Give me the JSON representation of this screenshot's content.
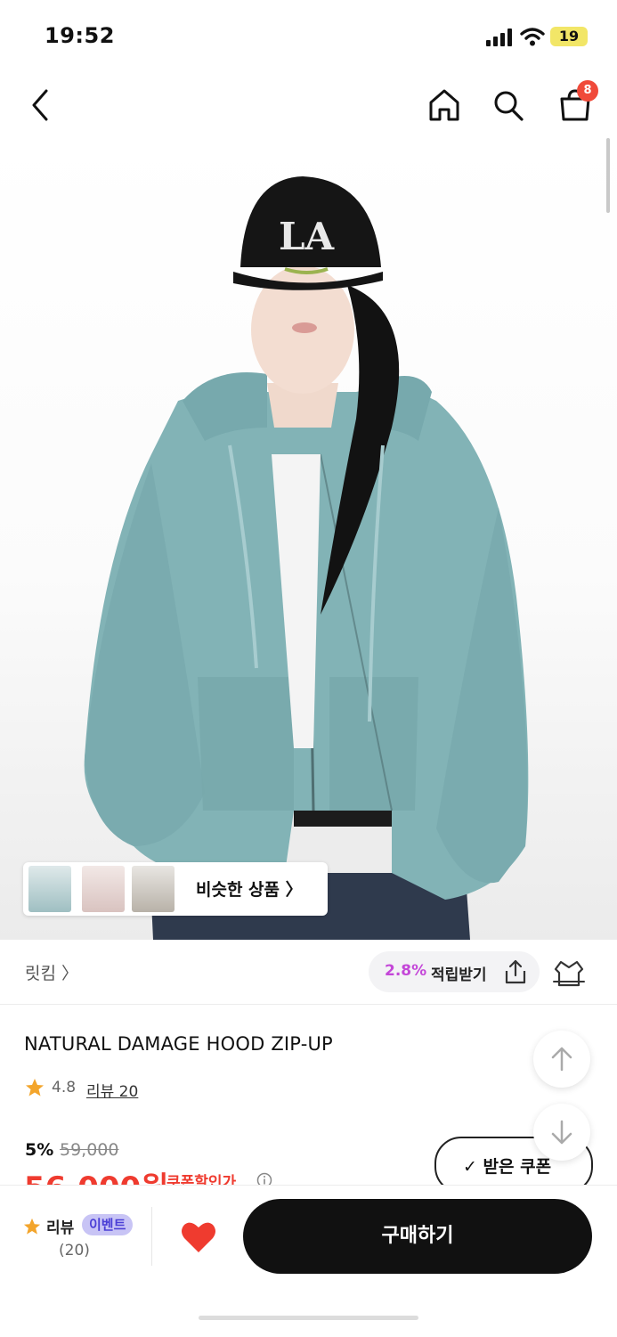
{
  "status_bar": {
    "time": "19:52",
    "battery": "19"
  },
  "header": {
    "cart_count": "8"
  },
  "hero": {
    "cap_text": "LA",
    "similar_products_label": "비슷한 상품 〉",
    "thumbnails": [
      "thumb-1",
      "thumb-2",
      "thumb-3"
    ]
  },
  "brand": {
    "name": "릿킴 〉"
  },
  "points": {
    "percent": "2.8%",
    "label": "적립받기"
  },
  "product": {
    "title": "NATURAL DAMAGE HOOD ZIP-UP",
    "rating": "4.8",
    "review_link": "리뷰 20",
    "discount": "5%",
    "original_price": "59,000",
    "sale_price": "56,000원",
    "coupon_label": "쿠폰할인가"
  },
  "coupon_button": {
    "label": "✓ 받은 쿠폰"
  },
  "bottom_bar": {
    "review_label": "리뷰",
    "event_badge": "이벤트",
    "review_count": "(20)",
    "buy_label": "구매하기"
  },
  "colors": {
    "accent_red": "#ef3b2f",
    "points_purple": "#c447d8",
    "hoodie": "#82b3b6",
    "buy_button": "#111111"
  }
}
